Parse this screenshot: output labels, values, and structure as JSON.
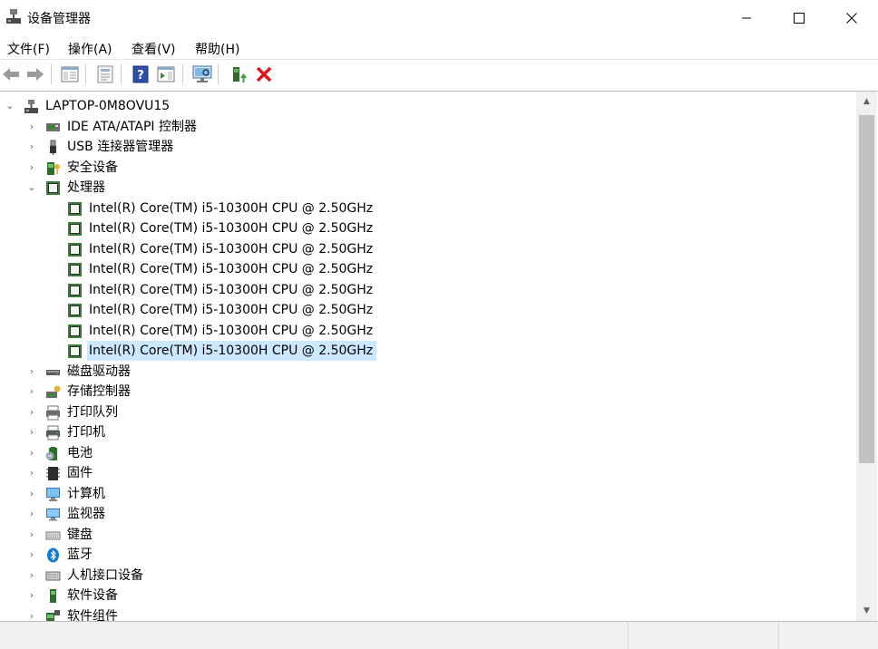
{
  "window": {
    "title": "设备管理器",
    "minimize_icon": "minimize-icon",
    "maximize_icon": "maximize-icon",
    "close_icon": "close-icon"
  },
  "menu": [
    "文件(F)",
    "操作(A)",
    "查看(V)",
    "帮助(H)"
  ],
  "toolbar": {
    "buttons": [
      "back-arrow-icon",
      "forward-arrow-icon",
      "console-tree-icon",
      "properties-icon",
      "help-icon",
      "action-pane-icon",
      "scan-hardware-icon",
      "update-driver-icon",
      "uninstall-device-icon"
    ],
    "uninstall_color": "#e0141e"
  },
  "tree": {
    "root": "LAPTOP-0M8OVU15",
    "categories_before": [
      {
        "label": "IDE ATA/ATAPI 控制器",
        "icon": "ide-controller-icon"
      },
      {
        "label": "USB 连接器管理器",
        "icon": "usb-icon"
      },
      {
        "label": "安全设备",
        "icon": "security-device-icon"
      }
    ],
    "processor": {
      "label": "处理器",
      "icon": "processor-icon",
      "children": [
        "Intel(R) Core(TM) i5-10300H CPU @ 2.50GHz",
        "Intel(R) Core(TM) i5-10300H CPU @ 2.50GHz",
        "Intel(R) Core(TM) i5-10300H CPU @ 2.50GHz",
        "Intel(R) Core(TM) i5-10300H CPU @ 2.50GHz",
        "Intel(R) Core(TM) i5-10300H CPU @ 2.50GHz",
        "Intel(R) Core(TM) i5-10300H CPU @ 2.50GHz",
        "Intel(R) Core(TM) i5-10300H CPU @ 2.50GHz",
        "Intel(R) Core(TM) i5-10300H CPU @ 2.50GHz"
      ]
    },
    "categories_after": [
      {
        "label": "磁盘驱动器",
        "icon": "disk-drive-icon"
      },
      {
        "label": "存储控制器",
        "icon": "storage-controller-icon"
      },
      {
        "label": "打印队列",
        "icon": "print-queue-icon"
      },
      {
        "label": "打印机",
        "icon": "printer-icon"
      },
      {
        "label": "电池",
        "icon": "battery-icon"
      },
      {
        "label": "固件",
        "icon": "firmware-icon"
      },
      {
        "label": "计算机",
        "icon": "computer-icon"
      },
      {
        "label": "监视器",
        "icon": "monitor-icon"
      },
      {
        "label": "键盘",
        "icon": "keyboard-icon"
      },
      {
        "label": "蓝牙",
        "icon": "bluetooth-icon"
      },
      {
        "label": "人机接口设备",
        "icon": "hid-icon"
      },
      {
        "label": "软件设备",
        "icon": "software-device-icon"
      },
      {
        "label": "软件组件",
        "icon": "software-component-icon"
      }
    ]
  },
  "colors": {
    "selection": "#cce8ff",
    "chip_green": "#3a7a3a",
    "bluetooth": "#0a7bd6"
  }
}
